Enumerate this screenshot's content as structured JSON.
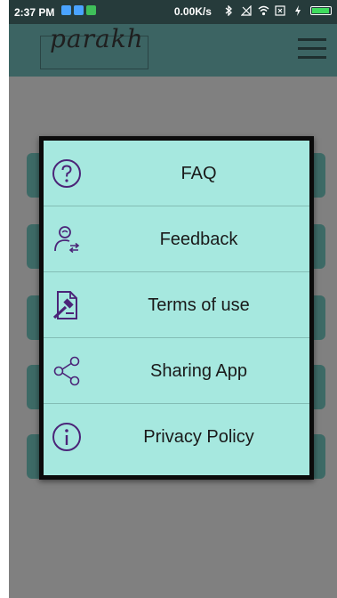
{
  "status_bar": {
    "time": "2:37 PM",
    "net_speed": "0.00K/s",
    "icons": [
      "notification-blue-icon",
      "notification-blue-icon",
      "notification-green-icon",
      "bluetooth-icon",
      "no-signal-icon",
      "wifi-icon",
      "sim-icon",
      "charging-icon",
      "battery-icon"
    ]
  },
  "app_bar": {
    "logo_text": "parakh",
    "menu_icon": "hamburger-menu-icon"
  },
  "menu": {
    "items": [
      {
        "label": "FAQ",
        "icon": "question-circle-icon"
      },
      {
        "label": "Feedback",
        "icon": "feedback-person-icon"
      },
      {
        "label": "Terms of use",
        "icon": "document-gavel-icon"
      },
      {
        "label": "Sharing App",
        "icon": "share-icon"
      },
      {
        "label": "Privacy Policy",
        "icon": "info-circle-icon"
      }
    ]
  },
  "colors": {
    "status_bar": "#263b3b",
    "app_bar": "#3c6463",
    "overlay": "#808080",
    "dialog_bg": "#a6e8df",
    "icon_color": "#4b2478",
    "battery": "#3fdc5e"
  }
}
